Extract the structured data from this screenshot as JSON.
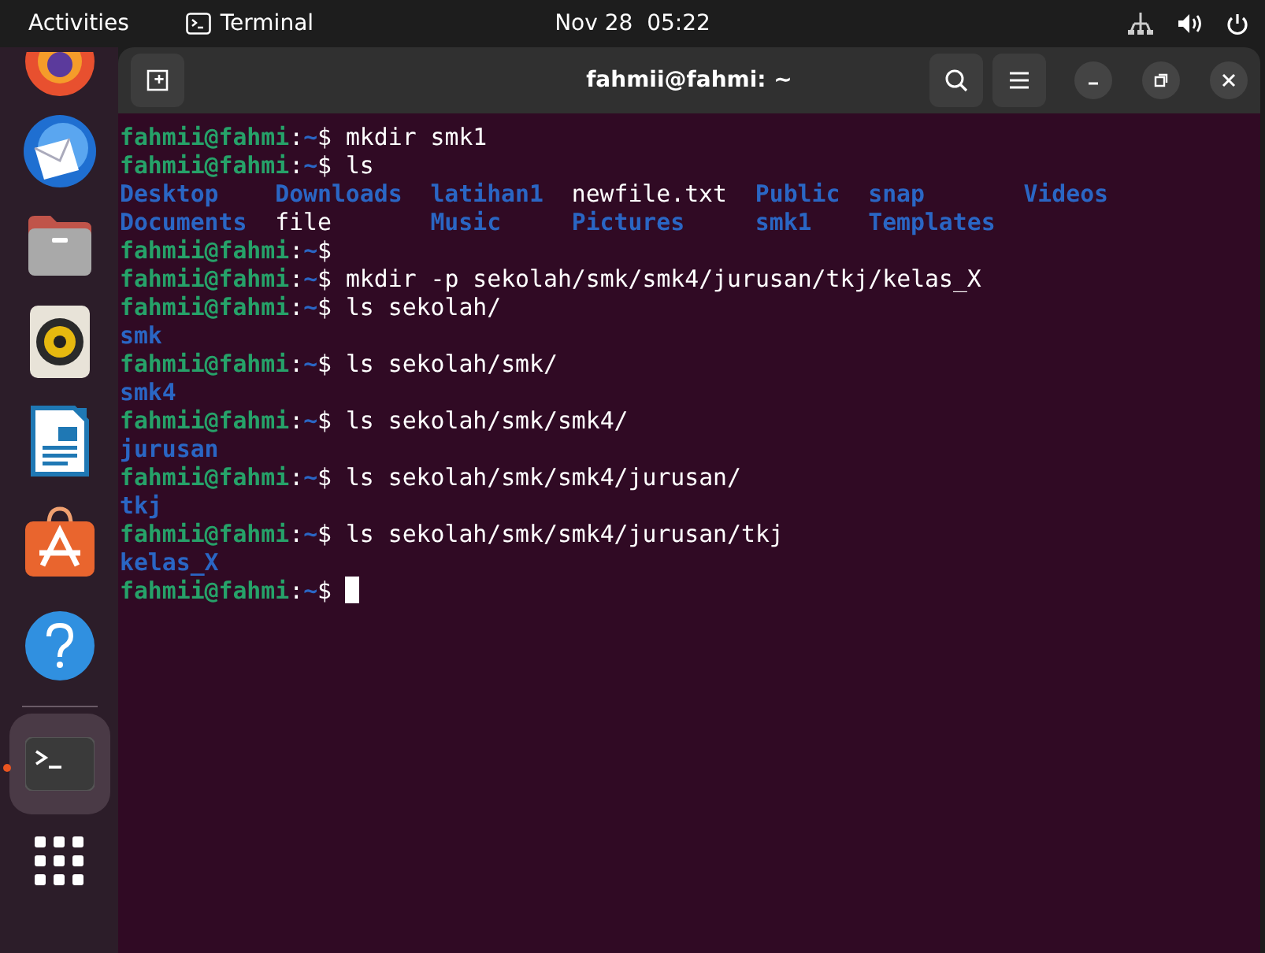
{
  "top_bar": {
    "activities": "Activities",
    "app_name": "Terminal",
    "clock": "Nov 28  05:22"
  },
  "dock": [
    {
      "kind": "browser",
      "selected": false,
      "running": false
    },
    {
      "kind": "mail",
      "selected": false,
      "running": false
    },
    {
      "kind": "files",
      "selected": false,
      "running": false
    },
    {
      "kind": "music",
      "selected": false,
      "running": false
    },
    {
      "kind": "writer",
      "selected": false,
      "running": false
    },
    {
      "kind": "store",
      "selected": false,
      "running": false
    },
    {
      "kind": "help",
      "selected": false,
      "running": false
    },
    {
      "kind": "terminal",
      "selected": true,
      "running": true
    }
  ],
  "window": {
    "title": "fahmii@fahmi: ~"
  },
  "terminal": {
    "lines": [
      {
        "kind": "prompt",
        "user": "fahmii@fahmi",
        "sep": ":",
        "path": "~",
        "symbol": "$",
        "command": "mkdir smk1",
        "cursor": false
      },
      {
        "kind": "prompt",
        "user": "fahmii@fahmi",
        "sep": ":",
        "path": "~",
        "symbol": "$",
        "command": "ls",
        "cursor": false
      },
      {
        "kind": "listing",
        "entries": [
          {
            "name": "Desktop",
            "kind": "dir"
          },
          {
            "name": "Downloads",
            "kind": "dir"
          },
          {
            "name": "latihan1",
            "kind": "dir"
          },
          {
            "name": "newfile.txt",
            "kind": "file"
          },
          {
            "name": "Public",
            "kind": "dir"
          },
          {
            "name": "snap",
            "kind": "dir"
          },
          {
            "name": "Videos",
            "kind": "dir"
          }
        ]
      },
      {
        "kind": "listing",
        "entries": [
          {
            "name": "Documents",
            "kind": "dir"
          },
          {
            "name": "file",
            "kind": "file"
          },
          {
            "name": "Music",
            "kind": "dir"
          },
          {
            "name": "Pictures",
            "kind": "dir"
          },
          {
            "name": "smk1",
            "kind": "dir"
          },
          {
            "name": "Templates",
            "kind": "dir"
          }
        ]
      },
      {
        "kind": "prompt",
        "user": "fahmii@fahmi",
        "sep": ":",
        "path": "~",
        "symbol": "$",
        "cursor": false
      },
      {
        "kind": "prompt",
        "user": "fahmii@fahmi",
        "sep": ":",
        "path": "~",
        "symbol": "$",
        "command": "mkdir -p sekolah/smk/smk4/jurusan/tkj/kelas_X",
        "cursor": false
      },
      {
        "kind": "prompt",
        "user": "fahmii@fahmi",
        "sep": ":",
        "path": "~",
        "symbol": "$",
        "command": "ls sekolah/",
        "cursor": false
      },
      {
        "kind": "listing",
        "entries": [
          {
            "name": "smk",
            "kind": "dir"
          }
        ]
      },
      {
        "kind": "prompt",
        "user": "fahmii@fahmi",
        "sep": ":",
        "path": "~",
        "symbol": "$",
        "command": "ls sekolah/smk/",
        "cursor": false
      },
      {
        "kind": "listing",
        "entries": [
          {
            "name": "smk4",
            "kind": "dir"
          }
        ]
      },
      {
        "kind": "prompt",
        "user": "fahmii@fahmi",
        "sep": ":",
        "path": "~",
        "symbol": "$",
        "command": "ls sekolah/smk/smk4/",
        "cursor": false
      },
      {
        "kind": "listing",
        "entries": [
          {
            "name": "jurusan",
            "kind": "dir"
          }
        ]
      },
      {
        "kind": "prompt",
        "user": "fahmii@fahmi",
        "sep": ":",
        "path": "~",
        "symbol": "$",
        "command": "ls sekolah/smk/smk4/jurusan/",
        "cursor": false
      },
      {
        "kind": "listing",
        "entries": [
          {
            "name": "tkj",
            "kind": "dir"
          }
        ]
      },
      {
        "kind": "prompt",
        "user": "fahmii@fahmi",
        "sep": ":",
        "path": "~",
        "symbol": "$",
        "command": "ls sekolah/smk/smk4/jurusan/tkj",
        "cursor": false
      },
      {
        "kind": "listing",
        "entries": [
          {
            "name": "kelas_X",
            "kind": "dir"
          }
        ]
      },
      {
        "kind": "prompt",
        "user": "fahmii@fahmi",
        "sep": ":",
        "path": "~",
        "symbol": "$",
        "cursor": true
      }
    ]
  }
}
